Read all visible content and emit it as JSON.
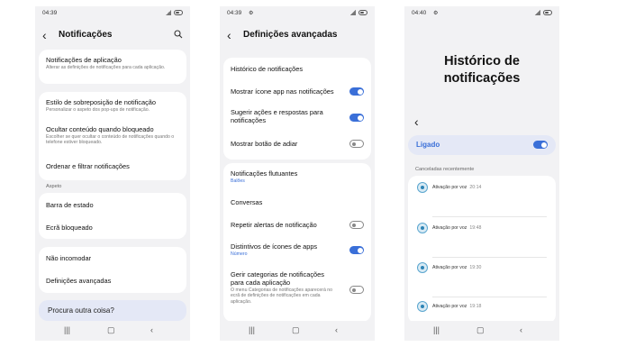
{
  "phone1": {
    "time": "04:39",
    "title": "Notificações",
    "items1": [
      {
        "title": "Notificações de aplicação",
        "sub": "Alterar as definições de notificações para cada aplicação."
      }
    ],
    "items2": [
      {
        "title": "Estilo de sobreposição de notificação",
        "sub": "Personalizar o aspeto dos pop-ups de notificação."
      },
      {
        "title": "Ocultar conteúdo quando bloqueado",
        "sub": "Escolher se quer ocultar o conteúdo de notificações quando o telefone estiver bloqueado."
      },
      {
        "title": "Ordenar e filtrar notificações",
        "sub": ""
      }
    ],
    "section_aspeto": "Aspeto",
    "items3": [
      {
        "title": "Barra de estado"
      },
      {
        "title": "Ecrã bloqueado"
      }
    ],
    "items4": [
      {
        "title": "Não incomodar"
      },
      {
        "title": "Definições avançadas"
      }
    ],
    "search_prompt": "Procura outra coisa?"
  },
  "phone2": {
    "time": "04:39",
    "title": "Definições avançadas",
    "card1": [
      {
        "title": "Histórico de notificações",
        "toggle": null
      },
      {
        "title": "Mostrar ícone app nas notificações",
        "toggle": "on"
      },
      {
        "title": "Sugerir ações e respostas para notificações",
        "toggle": "on"
      },
      {
        "title": "Mostrar botão de adiar",
        "toggle": "off"
      }
    ],
    "card2": [
      {
        "title": "Notificações flutuantes",
        "sub": "Balões",
        "toggle": null
      },
      {
        "title": "Conversas",
        "sub": "",
        "toggle": null
      },
      {
        "title": "Repetir alertas de notificação",
        "sub": "",
        "toggle": "off"
      },
      {
        "title": "Distintivos de ícones de apps",
        "sub": "Número",
        "toggle": "on"
      },
      {
        "title": "Gerir categorias de notificações para cada aplicação",
        "sub": "O menu Categorias de notificações aparecerá no ecrã de definições de notificações em cada aplicação.",
        "toggle": "off"
      }
    ]
  },
  "phone3": {
    "time": "04:40",
    "title": "Histórico de notificações",
    "ligado": "Ligado",
    "recent_label": "Canceladas recentemente",
    "entries": [
      {
        "label": "Ativação por voz",
        "time": "20:14"
      },
      {
        "label": "Ativação por voz",
        "time": "19:48"
      },
      {
        "label": "Ativação por voz",
        "time": "19:30"
      },
      {
        "label": "Ativação por voz",
        "time": "19:18"
      }
    ]
  },
  "icons": [
    "back-arrow-icon",
    "search-icon",
    "signal-icon",
    "battery-icon",
    "settings-gear-icon",
    "voice-activation-icon",
    "nav-recents-icon",
    "nav-home-icon",
    "nav-back-icon"
  ],
  "colors": {
    "accent": "#3a6fd8",
    "background": "#f2f2f4",
    "card": "#ffffff",
    "search_card": "#e4e8f6"
  }
}
